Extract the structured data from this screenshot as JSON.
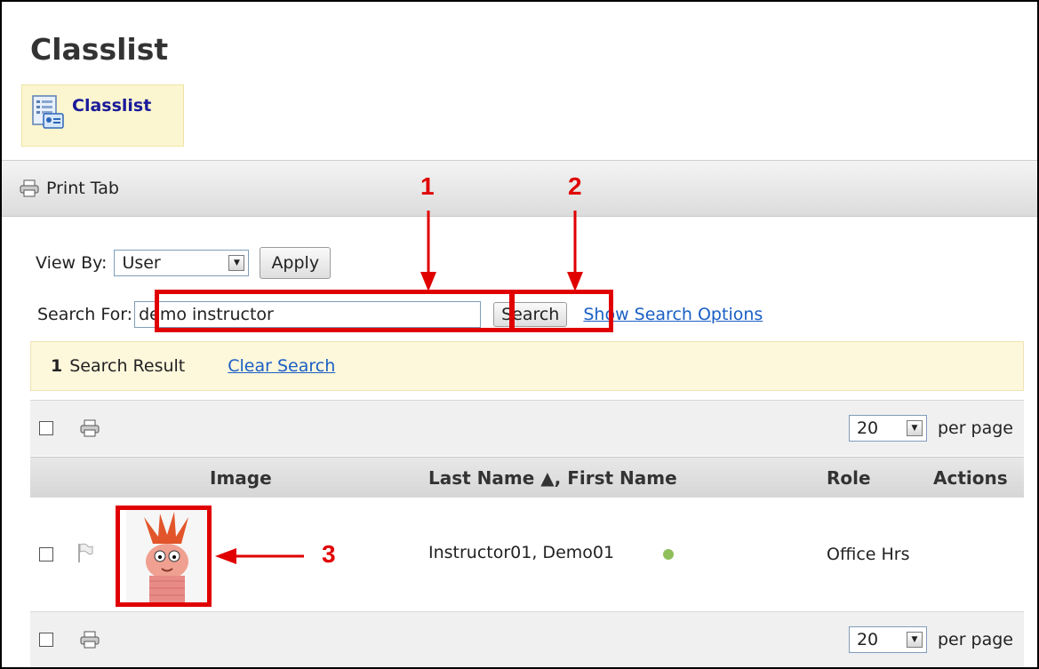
{
  "page": {
    "title": "Classlist"
  },
  "classlist_link": {
    "label": "Classlist"
  },
  "tab_bar": {
    "print_tab_label": "Print Tab"
  },
  "view_by": {
    "label": "View By:",
    "value": "User",
    "apply_label": "Apply"
  },
  "search": {
    "label": "Search For:",
    "value": "demo instructor",
    "button_label": "Search",
    "options_link": "Show Search Options"
  },
  "result": {
    "count": "1",
    "text": "Search Result",
    "clear_label": "Clear Search"
  },
  "paging": {
    "per_page_value": "20",
    "per_page_label": "per page"
  },
  "table": {
    "columns": {
      "image": "Image",
      "name": "Last Name ▲, First Name",
      "role": "Role",
      "actions": "Actions"
    },
    "rows": [
      {
        "name": "Instructor01, Demo01",
        "role": "Office Hrs",
        "status_color": "#8fbf5a"
      }
    ]
  },
  "annotations": {
    "label_1": "1",
    "label_2": "2",
    "label_3": "3",
    "color": "#e00000"
  }
}
